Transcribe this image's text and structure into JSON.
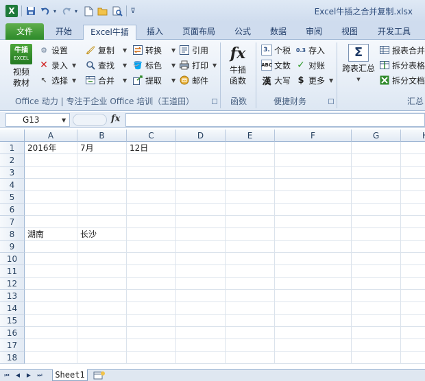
{
  "window": {
    "title": "Excel牛插之合并复制.xlsx",
    "app_logo": "X"
  },
  "quick_access": {
    "icons": [
      "excel-logo-icon",
      "save-icon",
      "undo-icon",
      "redo-icon",
      "new-doc-icon",
      "open-folder-icon",
      "print-preview-icon",
      "customize-icon"
    ]
  },
  "tabs": [
    {
      "label": "文件"
    },
    {
      "label": "开始"
    },
    {
      "label": "Excel牛插"
    },
    {
      "label": "插入"
    },
    {
      "label": "页面布局"
    },
    {
      "label": "公式"
    },
    {
      "label": "数据"
    },
    {
      "label": "审阅"
    },
    {
      "label": "视图"
    },
    {
      "label": "开发工具"
    }
  ],
  "ribbon": {
    "video": {
      "badge_top": "牛插",
      "badge_bottom": "EXCEL",
      "label_line1": "视频",
      "label_line2": "教材"
    },
    "col1": {
      "settings": "设置",
      "enter": "录入",
      "select": "选择"
    },
    "col2": {
      "copy": "复制",
      "find": "查找",
      "merge": "合并"
    },
    "col3": {
      "convert": "转换",
      "color": "标色",
      "extract": "提取"
    },
    "col4": {
      "quote": "引用",
      "print": "打印",
      "mail": "邮件"
    },
    "office_group_label": "Office 动力 | 专注于企业 Office 培训（王道田）",
    "func": {
      "glyph": "fx",
      "line1": "牛插",
      "line2": "函数",
      "group_label": "函数"
    },
    "finance": {
      "tax": "个税",
      "tax_icon": "3.",
      "deposit": "存入",
      "deposit_icon": "0.3",
      "text_num": "文数",
      "text_num_icon": "ABC",
      "check": "对账",
      "big": "大写",
      "big_icon": "漢",
      "more": "更多",
      "more_icon": "$",
      "group_label": "便捷财务"
    },
    "summary": {
      "glyph": "Σ",
      "cross": "跨表汇总",
      "report_merge": "报表合并",
      "split_table": "拆分表格",
      "split_doc": "拆分文档",
      "group_label": "汇总"
    }
  },
  "formula_bar": {
    "name_box": "G13",
    "fx_label": "fx",
    "formula": ""
  },
  "grid": {
    "columns": [
      "A",
      "B",
      "C",
      "D",
      "E",
      "F",
      "G",
      "H"
    ],
    "rows": [
      "1",
      "2",
      "3",
      "4",
      "5",
      "6",
      "7",
      "8",
      "9",
      "10",
      "11",
      "12",
      "13",
      "14",
      "15",
      "16",
      "17",
      "18"
    ],
    "cells": {
      "A1": "2016年",
      "B1": "7月",
      "C1": "12日",
      "A8": "湖南",
      "B8": "长沙"
    }
  },
  "sheets": [
    {
      "name": "Sheet1"
    }
  ]
}
